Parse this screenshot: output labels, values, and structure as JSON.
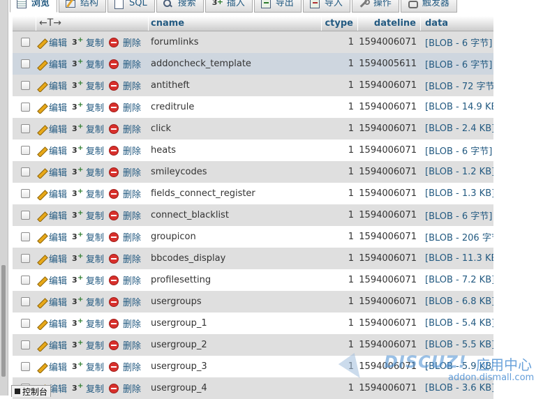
{
  "tabs": [
    {
      "label": "浏览",
      "icon": "browse-icon",
      "active": true
    },
    {
      "label": "结构",
      "icon": "structure-icon"
    },
    {
      "label": "SQL",
      "icon": "sql-icon"
    },
    {
      "label": "搜索",
      "icon": "search-icon"
    },
    {
      "label": "插入",
      "icon": "insert-icon"
    },
    {
      "label": "导出",
      "icon": "export-icon"
    },
    {
      "label": "导入",
      "icon": "import-icon"
    },
    {
      "label": "操作",
      "icon": "operations-icon"
    },
    {
      "label": "触发器",
      "icon": "triggers-icon"
    }
  ],
  "table": {
    "header_arrows": "←T→",
    "columns": {
      "cname": "cname",
      "ctype": "ctype",
      "dateline": "dateline",
      "data": "data"
    },
    "actions": {
      "edit": "编辑",
      "copy": "复制",
      "delete": "删除"
    },
    "rows": [
      {
        "cname": "forumlinks",
        "ctype": "1",
        "dateline": "1594006071",
        "data": "[BLOB - 6 字节]"
      },
      {
        "cname": "addoncheck_template",
        "ctype": "1",
        "dateline": "1594005611",
        "data": "[BLOB - 6 字节]"
      },
      {
        "cname": "antitheft",
        "ctype": "1",
        "dateline": "1594006071",
        "data": "[BLOB - 72 字节]"
      },
      {
        "cname": "creditrule",
        "ctype": "1",
        "dateline": "1594006071",
        "data": "[BLOB - 14.9 KB]"
      },
      {
        "cname": "click",
        "ctype": "1",
        "dateline": "1594006071",
        "data": "[BLOB - 2.4 KB]"
      },
      {
        "cname": "heats",
        "ctype": "1",
        "dateline": "1594006071",
        "data": "[BLOB - 6 字节]"
      },
      {
        "cname": "smileycodes",
        "ctype": "1",
        "dateline": "1594006071",
        "data": "[BLOB - 1.2 KB]"
      },
      {
        "cname": "fields_connect_register",
        "ctype": "1",
        "dateline": "1594006071",
        "data": "[BLOB - 1.3 KB]"
      },
      {
        "cname": "connect_blacklist",
        "ctype": "1",
        "dateline": "1594006071",
        "data": "[BLOB - 6 字节]"
      },
      {
        "cname": "groupicon",
        "ctype": "1",
        "dateline": "1594006071",
        "data": "[BLOB - 206 字节]"
      },
      {
        "cname": "bbcodes_display",
        "ctype": "1",
        "dateline": "1594006071",
        "data": "[BLOB - 11.3 KB]"
      },
      {
        "cname": "profilesetting",
        "ctype": "1",
        "dateline": "1594006071",
        "data": "[BLOB - 7.2 KB]"
      },
      {
        "cname": "usergroups",
        "ctype": "1",
        "dateline": "1594006071",
        "data": "[BLOB - 6.8 KB]"
      },
      {
        "cname": "usergroup_1",
        "ctype": "1",
        "dateline": "1594006071",
        "data": "[BLOB - 5.4 KB]"
      },
      {
        "cname": "usergroup_2",
        "ctype": "1",
        "dateline": "1594006071",
        "data": "[BLOB - 5.5 KB]"
      },
      {
        "cname": "usergroup_3",
        "ctype": "1",
        "dateline": "1594006071",
        "data": "[BLOB - 5.9 KB]"
      },
      {
        "cname": "usergroup_4",
        "ctype": "1",
        "dateline": "1594006071",
        "data": "[BLOB - 3.6 KB]"
      }
    ],
    "highlighted_row": 1
  },
  "console": {
    "label": "控制台"
  },
  "watermark": {
    "logo": "DISCUZ!",
    "text": "应用中心",
    "url": "addon.dismall.com"
  },
  "colors": {
    "link": "#235a81",
    "row_even": "#dfdfdf",
    "row_highlight": "#ced6df",
    "delete": "#d8302c"
  }
}
